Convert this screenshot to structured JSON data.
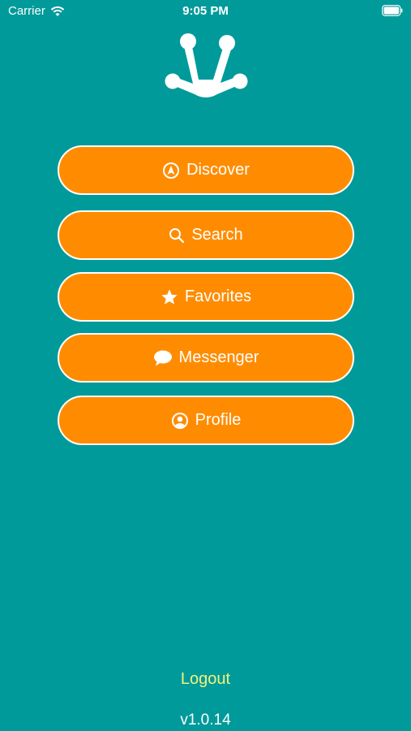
{
  "status_bar": {
    "carrier": "Carrier",
    "time": "9:05 PM",
    "wifi_icon": "wifi-icon",
    "battery_icon": "battery-icon"
  },
  "logo": {
    "icon": "frog-foot-logo"
  },
  "menu": {
    "items": [
      {
        "label": "Discover",
        "icon": "compass-icon"
      },
      {
        "label": "Search",
        "icon": "search-icon"
      },
      {
        "label": "Favorites",
        "icon": "star-icon"
      },
      {
        "label": "Messenger",
        "icon": "chat-bubble-icon"
      },
      {
        "label": "Profile",
        "icon": "user-circle-icon"
      }
    ]
  },
  "footer": {
    "logout_label": "Logout",
    "version": "v1.0.14"
  },
  "colors": {
    "background": "#019a9a",
    "button": "#ff8c00",
    "logout": "#f3f37a"
  }
}
